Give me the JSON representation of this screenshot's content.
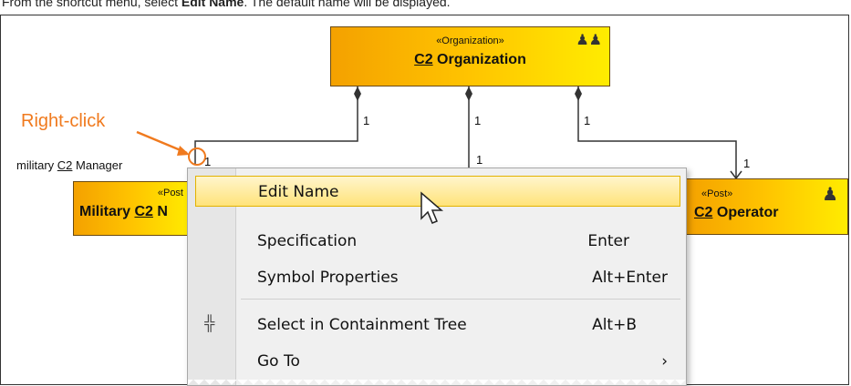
{
  "instruction": {
    "prefix": "From the shortcut menu, select ",
    "bold": "Edit Name",
    "suffix": ". The default name will be displayed."
  },
  "diagram": {
    "top_node": {
      "stereotype": "«Organization»",
      "name_c2": "C2",
      "name_rest": " Organization",
      "icon": "organization-icon"
    },
    "left_node": {
      "stereotype": "«Post",
      "name_prefix": "Military ",
      "name_c2": "C2",
      "name_rest": " N"
    },
    "right_node": {
      "stereotype": "«Post»",
      "name_c2": "C2",
      "name_rest": " Operator",
      "icon": "post-icon"
    },
    "multiplicities": [
      "1",
      "1",
      "1",
      "1",
      "1",
      "1"
    ],
    "role_label_prefix": "military ",
    "role_label_c2": "C2",
    "role_label_rest": " Manager",
    "annotation": "Right-click"
  },
  "context_menu": {
    "items": [
      {
        "label": "Edit Name",
        "shortcut": "",
        "highlighted": true
      },
      {
        "label": "Specification",
        "shortcut": "Enter"
      },
      {
        "label": "Symbol Properties",
        "shortcut": "Alt+Enter"
      },
      {
        "label": "Select in Containment Tree",
        "shortcut": "Alt+B",
        "icon": "containment-tree-icon"
      },
      {
        "label": "Go To",
        "shortcut": "›",
        "submenu": true
      }
    ]
  },
  "colors": {
    "annotation": "#f07a1e",
    "node_start": "#f4a100",
    "node_end": "#ffec00",
    "highlight": "#ffe37a"
  }
}
